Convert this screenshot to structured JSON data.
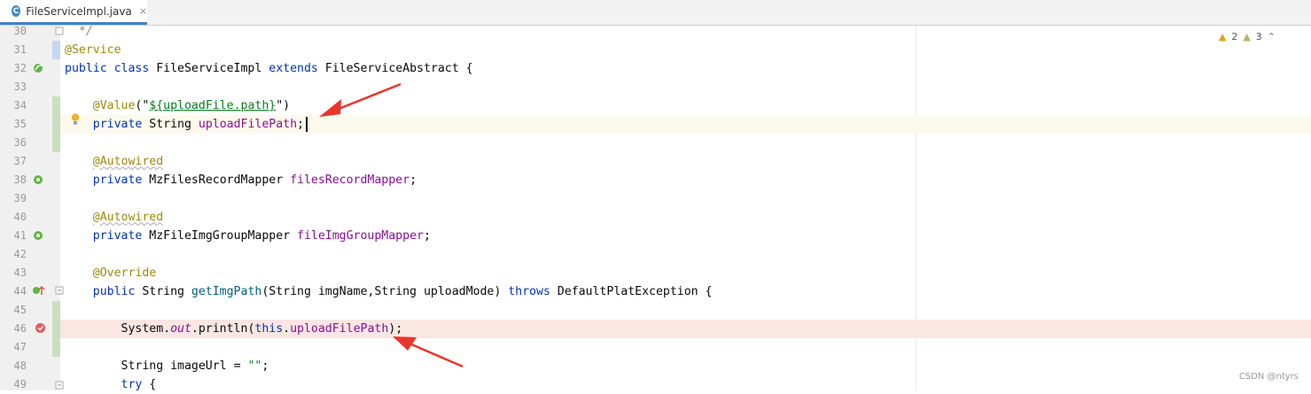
{
  "tab": {
    "icon": "C",
    "label": "FileServiceImpl.java",
    "close": "×"
  },
  "inspections": {
    "warnings": "2",
    "weak_warnings": "3"
  },
  "lines": [
    {
      "n": "30",
      "segs": [
        {
          "t": "  */",
          "c": "cmt"
        }
      ]
    },
    {
      "n": "31",
      "segs": [
        {
          "t": "@Service",
          "c": "ann"
        }
      ]
    },
    {
      "n": "32",
      "segs": [
        {
          "t": "public class ",
          "c": "kw"
        },
        {
          "t": "FileServiceImpl ",
          "c": ""
        },
        {
          "t": "extends ",
          "c": "kw"
        },
        {
          "t": "FileServiceAbstract {",
          "c": ""
        }
      ]
    },
    {
      "n": "33",
      "segs": []
    },
    {
      "n": "34",
      "segs": [
        {
          "t": "    ",
          "c": ""
        },
        {
          "t": "@Value",
          "c": "ann"
        },
        {
          "t": "(\"",
          "c": ""
        },
        {
          "t": "${uploadFile.path}",
          "c": "str uline"
        },
        {
          "t": "\")",
          "c": ""
        }
      ]
    },
    {
      "n": "35",
      "segs": [
        {
          "t": "    ",
          "c": ""
        },
        {
          "t": "private ",
          "c": "kw"
        },
        {
          "t": "String ",
          "c": ""
        },
        {
          "t": "uploadFilePath",
          "c": "fld"
        },
        {
          "t": ";",
          "c": ""
        }
      ]
    },
    {
      "n": "36",
      "segs": []
    },
    {
      "n": "37",
      "segs": [
        {
          "t": "    ",
          "c": ""
        },
        {
          "t": "@Autowired",
          "c": "ann wavy"
        }
      ]
    },
    {
      "n": "38",
      "segs": [
        {
          "t": "    ",
          "c": ""
        },
        {
          "t": "private ",
          "c": "kw"
        },
        {
          "t": "MzFilesRecordMapper ",
          "c": ""
        },
        {
          "t": "filesRecordMapper",
          "c": "fld"
        },
        {
          "t": ";",
          "c": ""
        }
      ]
    },
    {
      "n": "39",
      "segs": []
    },
    {
      "n": "40",
      "segs": [
        {
          "t": "    ",
          "c": ""
        },
        {
          "t": "@Autowired",
          "c": "ann wavy"
        }
      ]
    },
    {
      "n": "41",
      "segs": [
        {
          "t": "    ",
          "c": ""
        },
        {
          "t": "private ",
          "c": "kw"
        },
        {
          "t": "MzFileImgGroupMapper ",
          "c": ""
        },
        {
          "t": "fileImgGroupMapper",
          "c": "fld"
        },
        {
          "t": ";",
          "c": ""
        }
      ]
    },
    {
      "n": "42",
      "segs": []
    },
    {
      "n": "43",
      "segs": [
        {
          "t": "    ",
          "c": ""
        },
        {
          "t": "@Override",
          "c": "ann"
        }
      ]
    },
    {
      "n": "44",
      "segs": [
        {
          "t": "    ",
          "c": ""
        },
        {
          "t": "public ",
          "c": "kw"
        },
        {
          "t": "String ",
          "c": ""
        },
        {
          "t": "getImgPath",
          "c": "fn"
        },
        {
          "t": "(String imgName,String uploadMode) ",
          "c": ""
        },
        {
          "t": "throws ",
          "c": "kw"
        },
        {
          "t": "DefaultPlatException {",
          "c": ""
        }
      ]
    },
    {
      "n": "45",
      "segs": []
    },
    {
      "n": "46",
      "segs": [
        {
          "t": "        System.",
          "c": ""
        },
        {
          "t": "out",
          "c": "fld ital"
        },
        {
          "t": ".println(",
          "c": ""
        },
        {
          "t": "this",
          "c": "kw"
        },
        {
          "t": ".",
          "c": ""
        },
        {
          "t": "uploadFilePath",
          "c": "fld"
        },
        {
          "t": ");",
          "c": ""
        }
      ]
    },
    {
      "n": "47",
      "segs": []
    },
    {
      "n": "48",
      "segs": [
        {
          "t": "        String ",
          "c": ""
        },
        {
          "t": "imageUrl",
          "c": ""
        },
        {
          "t": " = ",
          "c": ""
        },
        {
          "t": "\"\"",
          "c": "str"
        },
        {
          "t": ";",
          "c": ""
        }
      ]
    },
    {
      "n": "49",
      "segs": [
        {
          "t": "        ",
          "c": ""
        },
        {
          "t": "try ",
          "c": "kw"
        },
        {
          "t": "{",
          "c": ""
        }
      ]
    }
  ],
  "watermark": "CSDN @ntyrs"
}
